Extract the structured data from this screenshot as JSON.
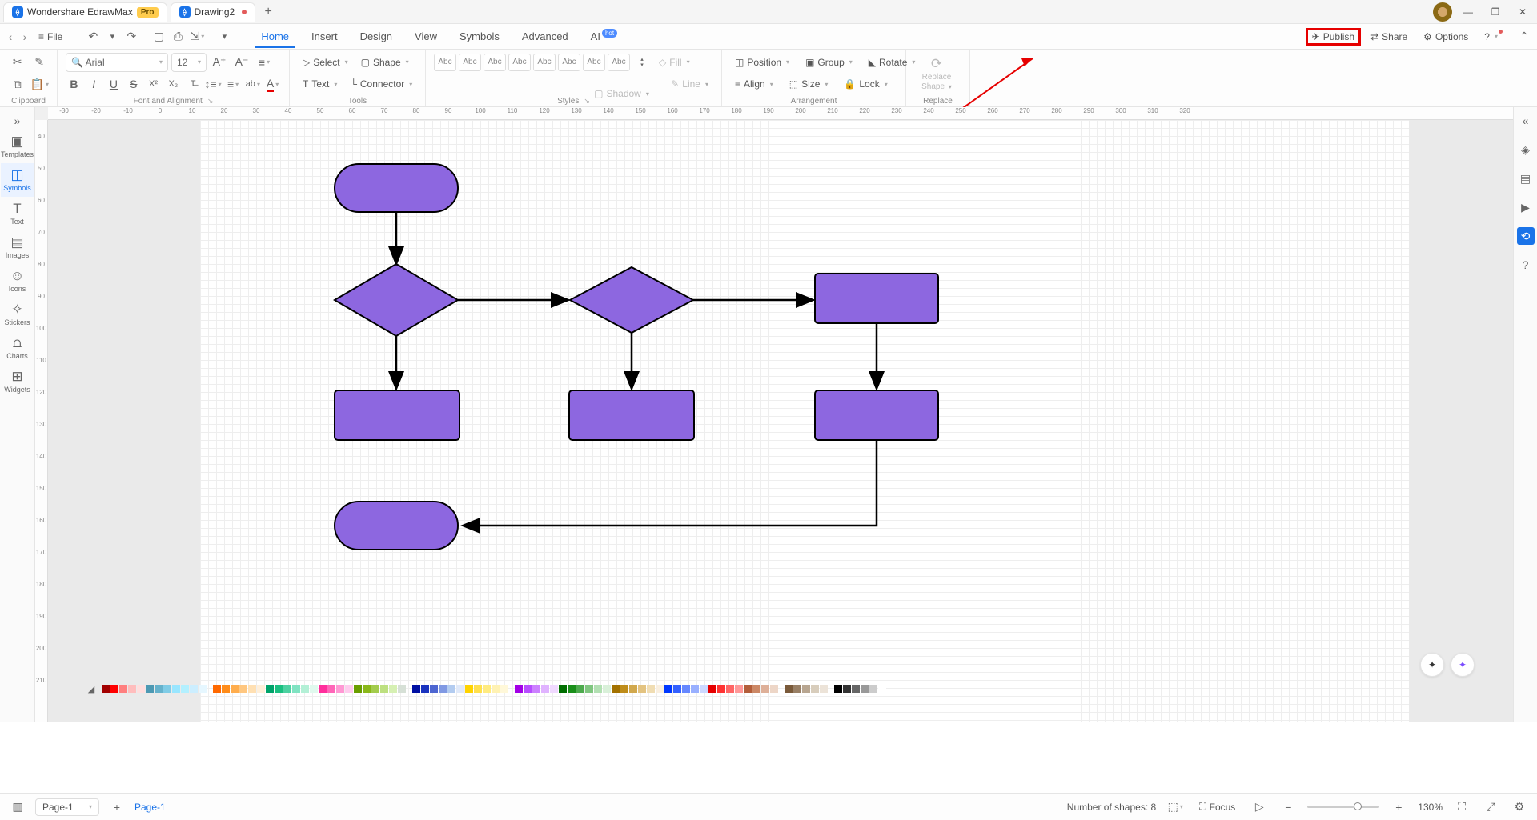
{
  "title": {
    "app": "Wondershare EdrawMax",
    "pro": "Pro",
    "doc": "Drawing2"
  },
  "menubar": {
    "file": "File",
    "tabs": [
      "Home",
      "Insert",
      "Design",
      "View",
      "Symbols",
      "Advanced"
    ],
    "ai": "AI",
    "hot": "hot",
    "active": "Home"
  },
  "actions": {
    "publish": "Publish",
    "share": "Share",
    "options": "Options"
  },
  "clipboard": {
    "label": "Clipboard"
  },
  "font": {
    "name": "Arial",
    "size": "12",
    "label": "Font and Alignment"
  },
  "tools": {
    "select": "Select",
    "shape": "Shape",
    "text": "Text",
    "connector": "Connector",
    "label": "Tools"
  },
  "styles": {
    "chip": "Abc",
    "label": "Styles",
    "fill": "Fill",
    "line": "Line",
    "shadow": "Shadow"
  },
  "arr": {
    "position": "Position",
    "align": "Align",
    "group": "Group",
    "size": "Size",
    "rotate": "Rotate",
    "lock": "Lock",
    "label": "Arrangement"
  },
  "replace": {
    "line1": "Replace",
    "line2": "Shape",
    "label": "Replace"
  },
  "leftRail": [
    {
      "icon": "▣",
      "label": "Templates",
      "key": "templates"
    },
    {
      "icon": "◫",
      "label": "Symbols",
      "key": "symbols"
    },
    {
      "icon": "T",
      "label": "Text",
      "key": "text"
    },
    {
      "icon": "▤",
      "label": "Images",
      "key": "images"
    },
    {
      "icon": "☺",
      "label": "Icons",
      "key": "icons"
    },
    {
      "icon": "✧",
      "label": "Stickers",
      "key": "stickers"
    },
    {
      "icon": "⩍",
      "label": "Charts",
      "key": "charts"
    },
    {
      "icon": "⊞",
      "label": "Widgets",
      "key": "widgets"
    }
  ],
  "rulerH": [
    "-30",
    "-20",
    "-10",
    "0",
    "10",
    "20",
    "30",
    "40",
    "50",
    "60",
    "70",
    "80",
    "90",
    "100",
    "110",
    "120",
    "130",
    "140",
    "150",
    "160",
    "170",
    "180",
    "190",
    "200",
    "210",
    "220",
    "230",
    "240",
    "250",
    "260",
    "270",
    "280",
    "290",
    "300",
    "310",
    "320"
  ],
  "rulerV": [
    "40",
    "50",
    "60",
    "70",
    "80",
    "90",
    "100",
    "110",
    "120",
    "130",
    "140",
    "150",
    "160",
    "170",
    "180",
    "190",
    "200",
    "210"
  ],
  "status": {
    "page": "Page-1",
    "shapes_label": "Number of shapes:",
    "shapes": "8",
    "focus": "Focus",
    "zoom": "130%"
  },
  "colors": [
    "#a20000",
    "#ff0000",
    "#ff7f7f",
    "#ffbdbd",
    "#ffdede",
    "#4d99b3",
    "#66b2cc",
    "#80cce6",
    "#99e6ff",
    "#b3f0ff",
    "#cceeff",
    "#e6f7ff",
    "",
    "#ff6900",
    "#ff8c1a",
    "#ffad4d",
    "#ffc780",
    "#ffe0b3",
    "#ffefd9",
    "#00a36a",
    "#1abf80",
    "#4dd1a1",
    "#80e3c2",
    "#b3f0d6",
    "#e0f9ee",
    "#ff2e9c",
    "#ff66b8",
    "#ff99d4",
    "#ffccee",
    "#6a9e00",
    "#8ab81a",
    "#a3cc4d",
    "#bde080",
    "#d6f0b3",
    "#d6e0d6",
    "",
    "#0010a3",
    "#1a33bf",
    "#4d66d1",
    "#8099e3",
    "#b3ccf0",
    "#e0e9f9",
    "#ffd300",
    "#ffe04d",
    "#ffeb80",
    "#fff2b3",
    "#fff8d9",
    "",
    "#a300e6",
    "#b84dff",
    "#cc80ff",
    "#e0b3ff",
    "#f0d9ff",
    "#006e00",
    "#1a8f1a",
    "#4daa4d",
    "#80c680",
    "#b3e0b3",
    "#d9f0d9",
    "#a37200",
    "#bf8d1a",
    "#d1a84d",
    "#e3c380",
    "#f0ddb3",
    "#f9efe0",
    "#0038ff",
    "#3360ff",
    "#6688ff",
    "#99b0ff",
    "#ccd8ff",
    "#e60000",
    "#ff3333",
    "#ff6666",
    "#ff9999",
    "#b35e3a",
    "#cc8866",
    "#deb099",
    "#edd6c7",
    "",
    "#7a5a3a",
    "#998066",
    "#b8a691",
    "#d8cdbc",
    "#ece3d8",
    "",
    "#000000",
    "#333333",
    "#666666",
    "#999999",
    "#cccccc",
    "#ffffff"
  ]
}
